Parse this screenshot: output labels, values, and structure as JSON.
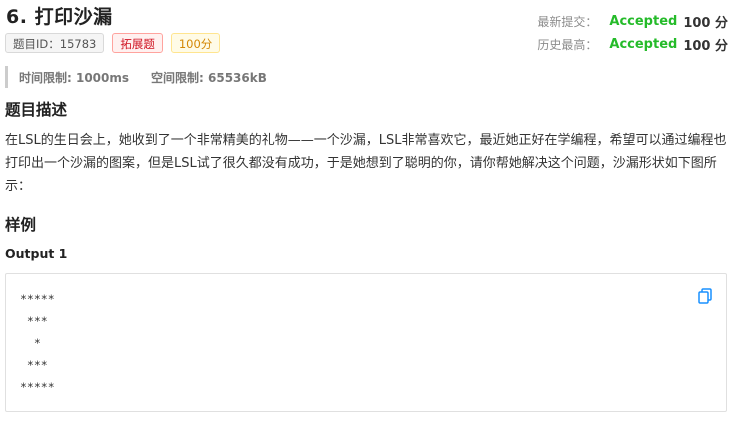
{
  "problem": {
    "number": "6.",
    "title": "打印沙漏",
    "tags": {
      "id": "题目ID：15783",
      "kind": "拓展题",
      "score": "100分"
    }
  },
  "status": {
    "latest_label": "最新提交：",
    "latest_result": "Accepted",
    "latest_score": "100 分",
    "best_label": "历史最高：",
    "best_result": "Accepted",
    "best_score": "100 分"
  },
  "limits": {
    "time": "时间限制: 1000ms",
    "memory": "空间限制: 65536kB"
  },
  "description": {
    "heading": "题目描述",
    "text": "在LSL的生日会上，她收到了一个非常精美的礼物——一个沙漏，LSL非常喜欢它，最近她正好在学编程，希望可以通过编程也打印出一个沙漏的图案，但是LSL试了很久都没有成功，于是她想到了聪明的你，请你帮她解决这个问题，沙漏形状如下图所示："
  },
  "sample": {
    "heading": "样例",
    "output_label": "Output 1",
    "output_text": "*****\n ***\n  *\n ***\n*****"
  },
  "colors": {
    "accepted": "#25bb2a",
    "kind_tag": "#cf1322",
    "score_tag": "#d48806",
    "copy_icon": "#1890ff"
  },
  "icons": {
    "copy": "copy-icon"
  }
}
